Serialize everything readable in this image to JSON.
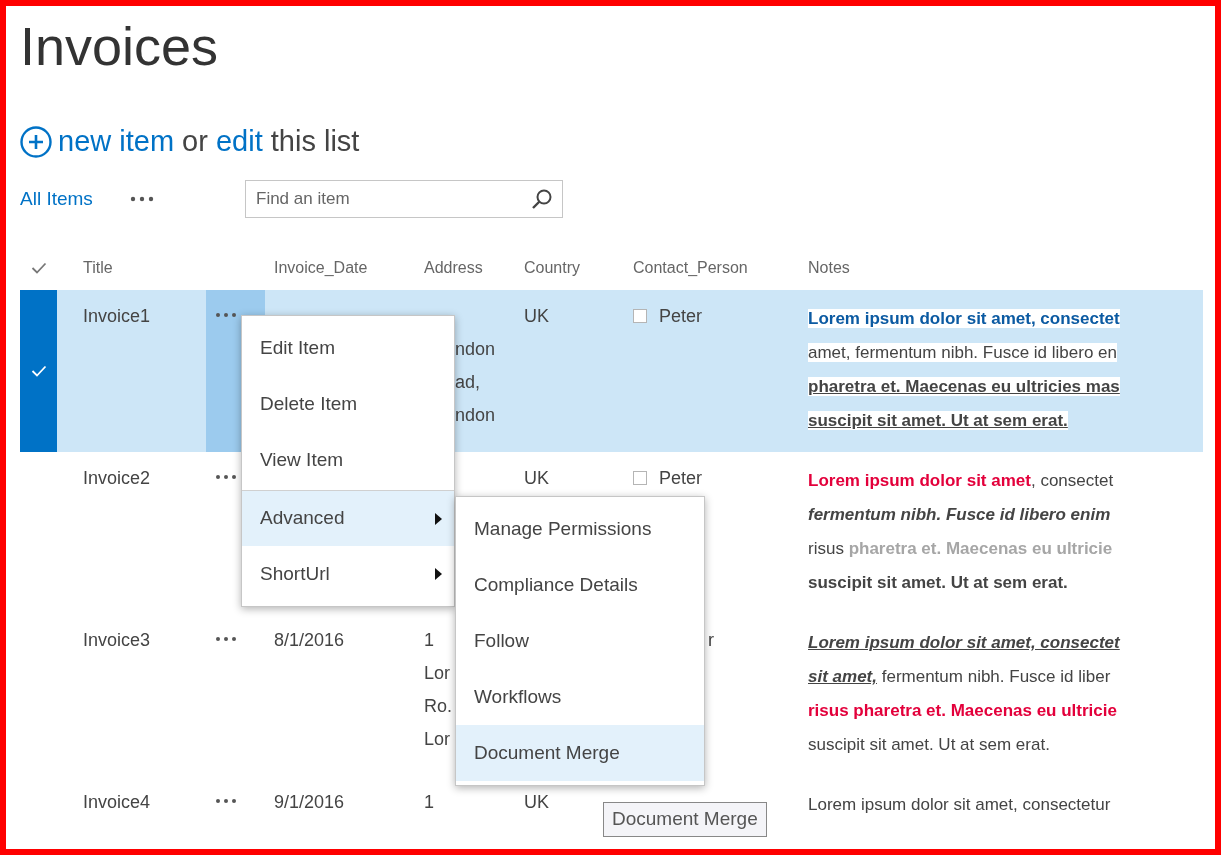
{
  "page_title": "Invoices",
  "command_bar": {
    "new_item": "new item",
    "or": "or",
    "edit": "edit",
    "this_list": "this list"
  },
  "view": "All Items",
  "search": {
    "placeholder": "Find an item"
  },
  "columns": [
    "Title",
    "Invoice_Date",
    "Address",
    "Country",
    "Contact_Person",
    "Notes"
  ],
  "rows": [
    {
      "selected": true,
      "menu_open": true,
      "title": "Invoice1",
      "address": {
        "lines": [
          "ndon",
          "ad,",
          "ndon"
        ],
        "covered": true
      },
      "country": "UK",
      "contact": {
        "checked": false,
        "name": "Peter",
        "covered": false
      },
      "notes": {
        "highlighted": true,
        "lines": [
          [
            {
              "text": "Lorem ipsum dolor sit amet, consectet",
              "bold": true,
              "italic": false,
              "underline": false,
              "color": "#0b5aa2"
            }
          ],
          [
            {
              "text": "amet, fermentum nibh. Fusce id libero en",
              "bold": false,
              "italic": false,
              "underline": false,
              "color": "#444444"
            }
          ],
          [
            {
              "text": "pharetra et. Maecenas eu ultricies mas",
              "bold": true,
              "italic": false,
              "underline": true,
              "color": "#444444"
            }
          ],
          [
            {
              "text": "suscipit sit amet. Ut at sem erat.",
              "bold": true,
              "italic": false,
              "underline": true,
              "color": "#444444"
            }
          ]
        ]
      }
    },
    {
      "selected": false,
      "menu_open": false,
      "title": "Invoice2",
      "country": "UK",
      "contact": {
        "checked": false,
        "name": "Peter",
        "covered": false
      },
      "notes": {
        "highlighted": false,
        "lines": [
          [
            {
              "text": "Lorem ipsum dolor sit amet",
              "bold": true,
              "italic": false,
              "underline": false,
              "color": "#e3003b"
            },
            {
              "text": ", consectet",
              "bold": false,
              "italic": false,
              "underline": false,
              "color": "#444444"
            }
          ],
          [
            {
              "text": "fermentum nibh. Fusce id libero enim",
              "bold": true,
              "italic": true,
              "underline": false,
              "color": "#444444"
            }
          ],
          [
            {
              "text": "risus ",
              "bold": false,
              "italic": false,
              "underline": false,
              "color": "#444444"
            },
            {
              "text": "pharetra et. Maecenas eu ultricie",
              "bold": true,
              "italic": false,
              "underline": false,
              "color": "#a6a6a6"
            }
          ],
          [
            {
              "text": "suscipit sit amet. Ut at sem erat.",
              "bold": true,
              "italic": false,
              "underline": false,
              "color": "#444444"
            }
          ]
        ]
      }
    },
    {
      "selected": false,
      "menu_open": false,
      "title": "Invoice3",
      "date": "8/1/2016",
      "address": {
        "lines": [
          "1",
          "Lor",
          "Ro.",
          "Lor"
        ],
        "covered": false
      },
      "contact": {
        "name": "r",
        "covered": true
      },
      "notes": {
        "highlighted": false,
        "lines": [
          [
            {
              "text": "Lorem ipsum dolor sit amet, consectet",
              "bold": true,
              "italic": true,
              "underline": true,
              "color": "#444444"
            }
          ],
          [
            {
              "text": "sit amet,",
              "bold": true,
              "italic": true,
              "underline": true,
              "color": "#444444"
            },
            {
              "text": " fermentum nibh. Fusce id liber",
              "bold": false,
              "italic": false,
              "underline": false,
              "color": "#444444"
            }
          ],
          [
            {
              "text": "risus pharetra et. Maecenas eu ultricie",
              "bold": true,
              "italic": false,
              "underline": false,
              "color": "#e3003b"
            }
          ],
          [
            {
              "text": "suscipit sit amet. Ut at sem erat.",
              "bold": false,
              "italic": false,
              "underline": false,
              "color": "#444444"
            }
          ]
        ]
      }
    },
    {
      "selected": false,
      "menu_open": false,
      "title": "Invoice4",
      "date": "9/1/2016",
      "address": {
        "lines": [
          "1"
        ],
        "covered": false
      },
      "country": "UK",
      "notes": {
        "highlighted": false,
        "lines": [
          [
            {
              "text": "Lorem ipsum dolor sit amet, consectetur",
              "bold": false,
              "italic": false,
              "underline": false,
              "color": "#444444"
            }
          ]
        ]
      }
    }
  ],
  "context_menu": [
    {
      "label": "Edit Item",
      "selected": false,
      "submenu": false,
      "separator_before": false
    },
    {
      "label": "Delete Item",
      "selected": false,
      "submenu": false,
      "separator_before": false
    },
    {
      "label": "View Item",
      "selected": false,
      "submenu": false,
      "separator_before": false
    },
    {
      "label": "Advanced",
      "selected": true,
      "submenu": true,
      "separator_before": true
    },
    {
      "label": "ShortUrl",
      "selected": false,
      "submenu": true,
      "separator_before": false
    }
  ],
  "submenu": [
    {
      "label": "Manage Permissions",
      "selected": false
    },
    {
      "label": "Compliance Details",
      "selected": false
    },
    {
      "label": "Follow",
      "selected": false
    },
    {
      "label": "Workflows",
      "selected": false
    },
    {
      "label": "Document Merge",
      "selected": true
    }
  ],
  "tooltip": "Document Merge"
}
